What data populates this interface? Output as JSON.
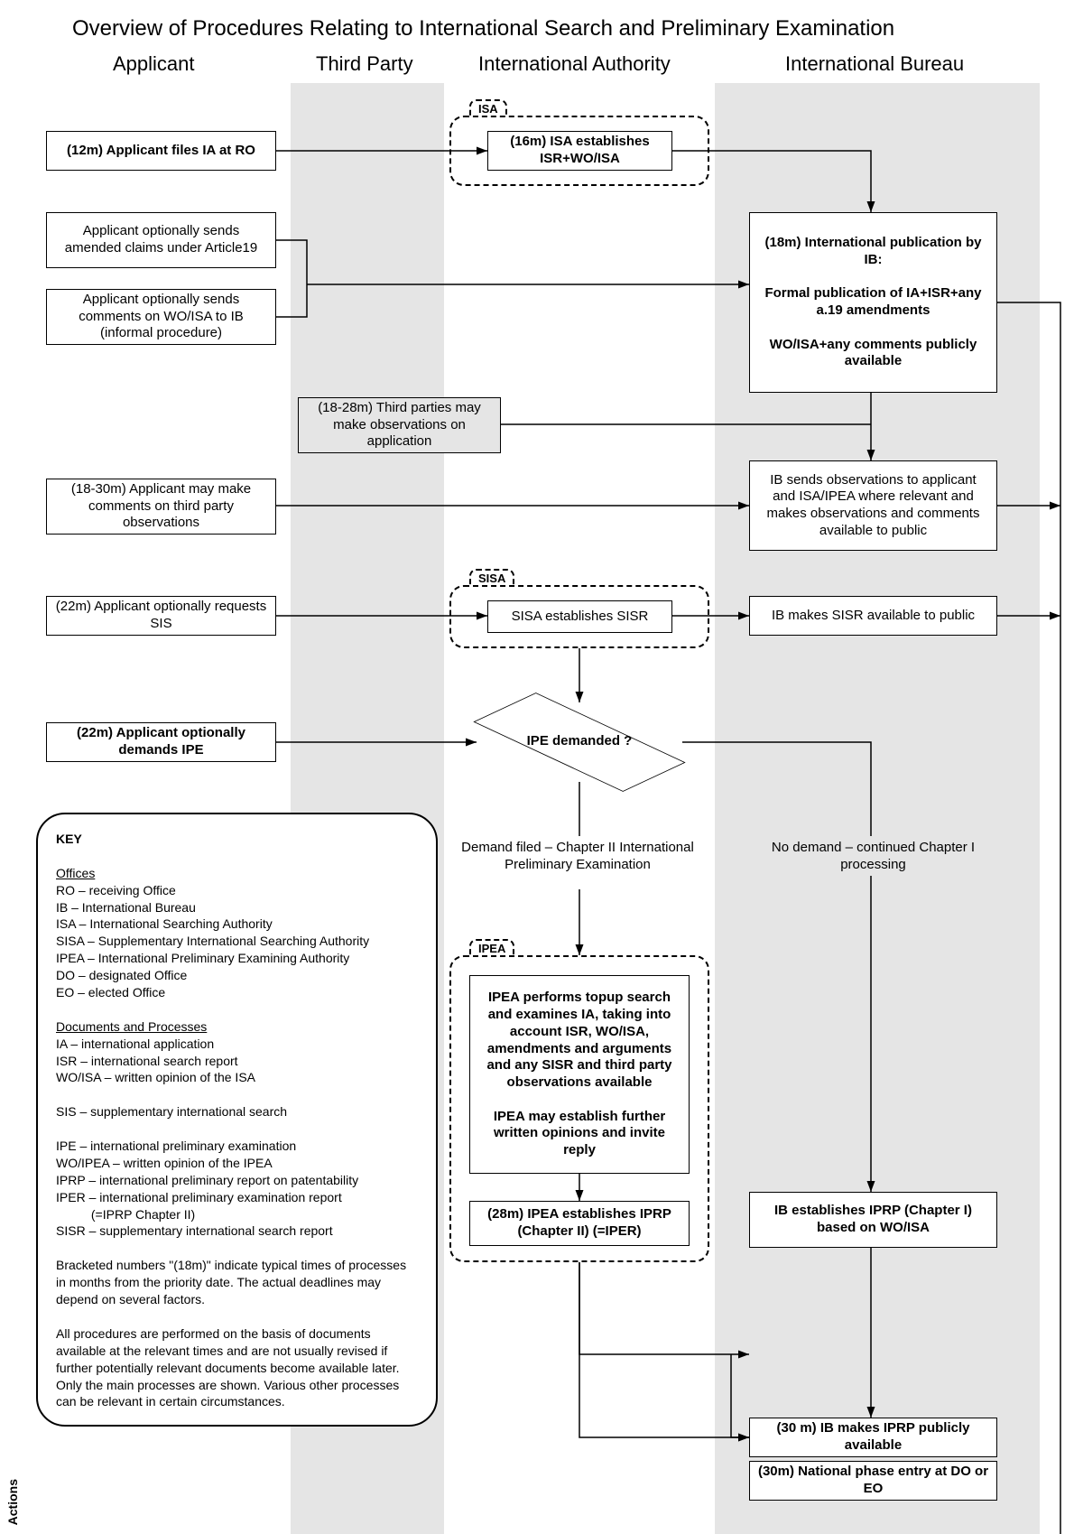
{
  "title": "Overview of Procedures Relating to International Search and Preliminary Examination",
  "columns": {
    "applicant": "Applicant",
    "thirdparty": "Third Party",
    "authority": "International Authority",
    "bureau": "International Bureau"
  },
  "tabs": {
    "isa": "ISA",
    "sisa": "SISA",
    "ipea": "IPEA"
  },
  "boxes": {
    "files_ia": "(12m) Applicant files IA at RO",
    "isa_establishes": "(16m) ISA establishes ISR+WO/ISA",
    "ib_publication": "(18m) International publication by IB:\n\nFormal publication of IA+ISR+any a.19 amendments\n\nWO/ISA+any comments publicly available",
    "amended_claims": "Applicant optionally sends amended claims under Article19",
    "comments_wo": "Applicant optionally sends comments on WO/ISA to IB (informal procedure)",
    "third_party_obs": "(18-28m) Third parties may make observations on application",
    "applicant_comments_obs": "(18-30m) Applicant may make comments on third party observations",
    "ib_sends_obs": "IB sends observations to applicant and ISA/IPEA where relevant and makes observations and comments available to public",
    "requests_sis": "(22m) Applicant optionally requests SIS",
    "sisa_establishes": "SISA establishes SISR",
    "ib_sisr_public": "IB makes SISR available to public",
    "demands_ipe": "(22m) Applicant optionally demands IPE",
    "ipea_performs": "IPEA performs topup search and examines IA, taking into account ISR, WO/ISA, amendments and arguments and any SISR and third party observations available\n\nIPEA may establish further written opinions and invite reply",
    "ipea_establishes": "(28m) IPEA establishes IPRP (Chapter II) (=IPER)",
    "ib_iprp_ch1": "IB establishes IPRP (Chapter I) based on WO/ISA",
    "ib_iprp_public": "(30 m) IB makes IPRP publicly available",
    "national_phase": "(30m) National phase entry at DO or EO"
  },
  "decision": {
    "ipe_demanded": "IPE demanded ?"
  },
  "branch_text": {
    "demand_filed": "Demand filed – Chapter II International Preliminary Examination",
    "no_demand": "No demand – continued Chapter I processing"
  },
  "key": {
    "heading": "KEY",
    "offices_h": "Offices",
    "offices": [
      "RO – receiving Office",
      "IB – International Bureau",
      "ISA – International Searching Authority",
      "SISA – Supplementary International Searching Authority",
      "IPEA – International Preliminary Examining Authority",
      "DO – designated Office",
      "EO – elected Office"
    ],
    "docs_h": "Documents and Processes",
    "docs": [
      "IA – international application",
      "ISR – international search report",
      "WO/ISA – written opinion of the ISA",
      "",
      "SIS – supplementary international search",
      "",
      "IPE – international preliminary examination",
      "WO/IPEA – written opinion of the IPEA",
      "IPRP – international preliminary report on patentability",
      "IPER – international preliminary examination report\n          (=IPRP Chapter II)",
      "SISR – supplementary international search report"
    ],
    "note1": "Bracketed numbers \"(18m)\" indicate typical times of processes in months from the priority date.  The actual deadlines may depend on several factors.",
    "note2": "All procedures are performed on the basis of documents available at the relevant times and are not usually revised if further potentially relevant documents become available later.  Only the main processes are shown.  Various other processes can be relevant in certain circumstances."
  },
  "side_label": "Actions"
}
